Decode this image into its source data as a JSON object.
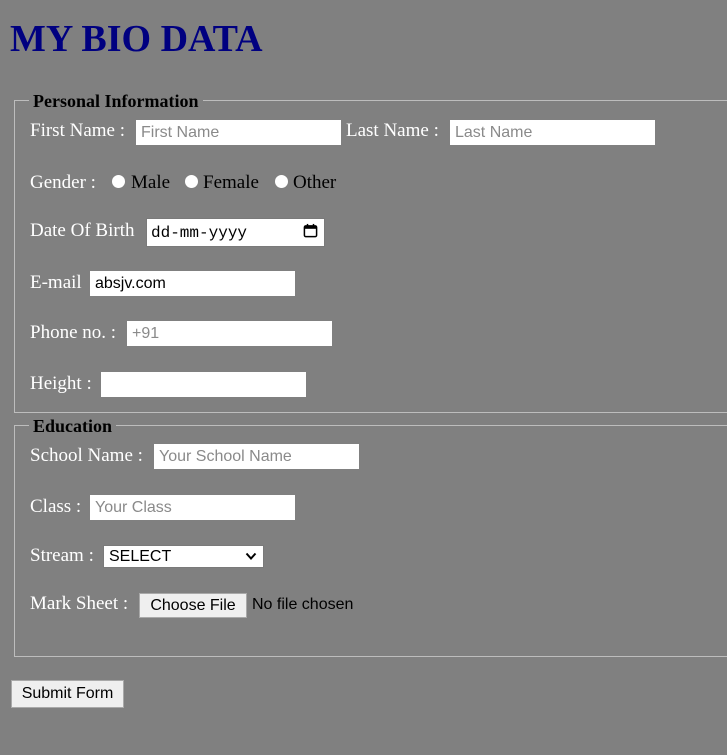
{
  "page_title": "MY BIO DATA",
  "personal": {
    "legend": "Personal Information",
    "first_name": {
      "label": "First Name :",
      "placeholder": "First Name"
    },
    "last_name": {
      "label": "Last Name :",
      "placeholder": "Last Name"
    },
    "gender": {
      "label": "Gender :",
      "options": [
        "Male",
        "Female",
        "Other"
      ]
    },
    "dob": {
      "label": "Date Of Birth",
      "placeholder": "dd-mm-yyyy",
      "icon": "calendar-icon"
    },
    "email": {
      "label": "E-mail",
      "value": "absjv.com"
    },
    "phone": {
      "label": "Phone no. :",
      "placeholder": "+91"
    },
    "height": {
      "label": "Height :",
      "value": ""
    }
  },
  "education": {
    "legend": "Education",
    "school": {
      "label": "School Name :",
      "placeholder": "Your School Name"
    },
    "class": {
      "label": "Class :",
      "placeholder": "Your Class"
    },
    "stream": {
      "label": "Stream :",
      "selected": "SELECT",
      "icon": "chevron-down-icon"
    },
    "marksheet": {
      "label": "Mark Sheet :",
      "button": "Choose File",
      "status": "No file chosen"
    }
  },
  "submit_label": "Submit Form"
}
